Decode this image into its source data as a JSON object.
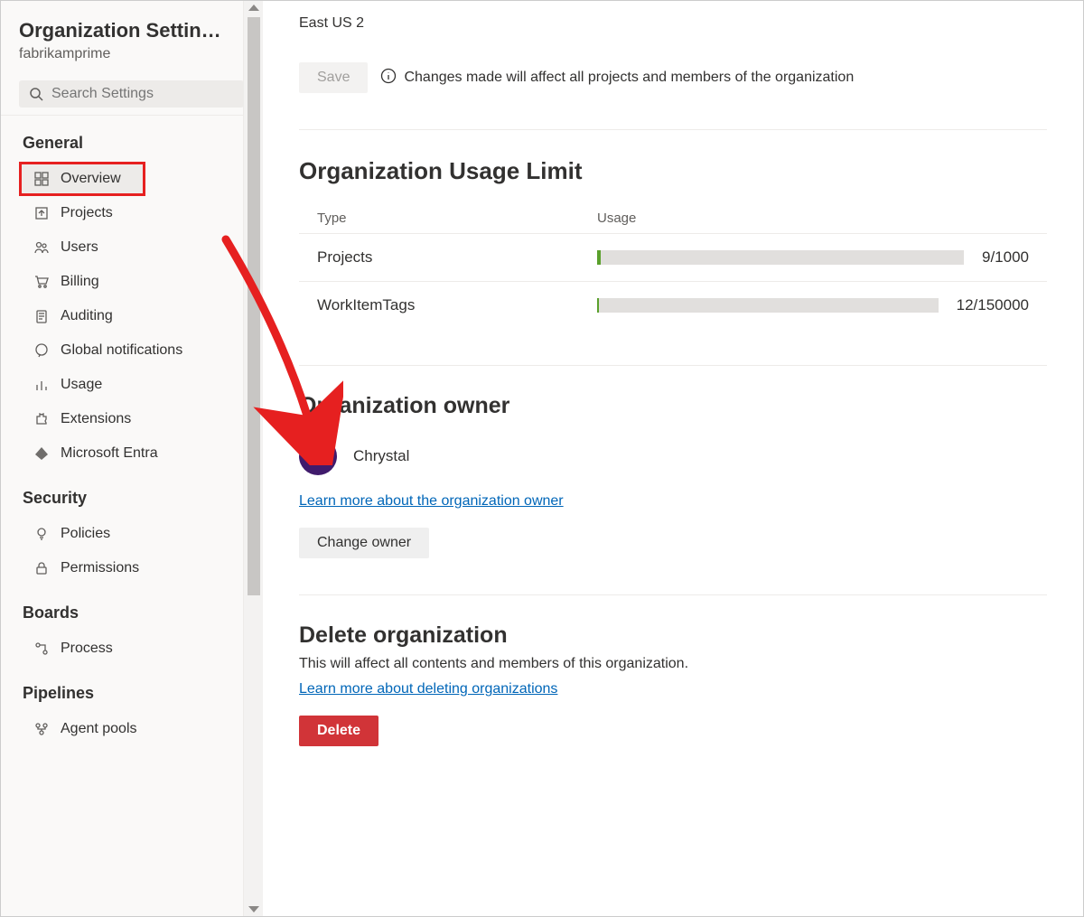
{
  "sidebar": {
    "title": "Organization Settin…",
    "subtitle": "fabrikamprime",
    "search_placeholder": "Search Settings",
    "groups": [
      {
        "title": "General",
        "items": [
          {
            "id": "overview",
            "label": "Overview",
            "icon": "grid-icon",
            "active": true,
            "highlight": true
          },
          {
            "id": "projects",
            "label": "Projects",
            "icon": "upload-icon"
          },
          {
            "id": "users",
            "label": "Users",
            "icon": "people-icon"
          },
          {
            "id": "billing",
            "label": "Billing",
            "icon": "cart-icon"
          },
          {
            "id": "auditing",
            "label": "Auditing",
            "icon": "clipboard-icon"
          },
          {
            "id": "global-notifications",
            "label": "Global notifications",
            "icon": "chat-icon"
          },
          {
            "id": "usage",
            "label": "Usage",
            "icon": "chart-icon"
          },
          {
            "id": "extensions",
            "label": "Extensions",
            "icon": "puzzle-icon"
          },
          {
            "id": "microsoft-entra",
            "label": "Microsoft Entra",
            "icon": "entra-icon"
          }
        ]
      },
      {
        "title": "Security",
        "items": [
          {
            "id": "policies",
            "label": "Policies",
            "icon": "bulb-icon"
          },
          {
            "id": "permissions",
            "label": "Permissions",
            "icon": "lock-icon"
          }
        ]
      },
      {
        "title": "Boards",
        "items": [
          {
            "id": "process",
            "label": "Process",
            "icon": "flow-icon"
          }
        ]
      },
      {
        "title": "Pipelines",
        "items": [
          {
            "id": "agent-pools",
            "label": "Agent pools",
            "icon": "agents-icon"
          }
        ]
      }
    ]
  },
  "main": {
    "region": "East US 2",
    "save_label": "Save",
    "save_warning": "Changes made will affect all projects and members of the organization",
    "usage": {
      "heading": "Organization Usage Limit",
      "col_type": "Type",
      "col_usage": "Usage",
      "rows": [
        {
          "type": "Projects",
          "used": 9,
          "limit": 1000,
          "display": "9/1000"
        },
        {
          "type": "WorkItemTags",
          "used": 12,
          "limit": 150000,
          "display": "12/150000"
        }
      ]
    },
    "owner": {
      "heading": "Organization owner",
      "initials": "CC",
      "name": "Chrystal",
      "learn_more_link": "Learn more about the organization owner",
      "change_button": "Change owner"
    },
    "delete": {
      "heading": "Delete organization",
      "description": "This will affect all contents and members of this organization.",
      "learn_more_link": "Learn more about deleting organizations",
      "button": "Delete"
    }
  }
}
